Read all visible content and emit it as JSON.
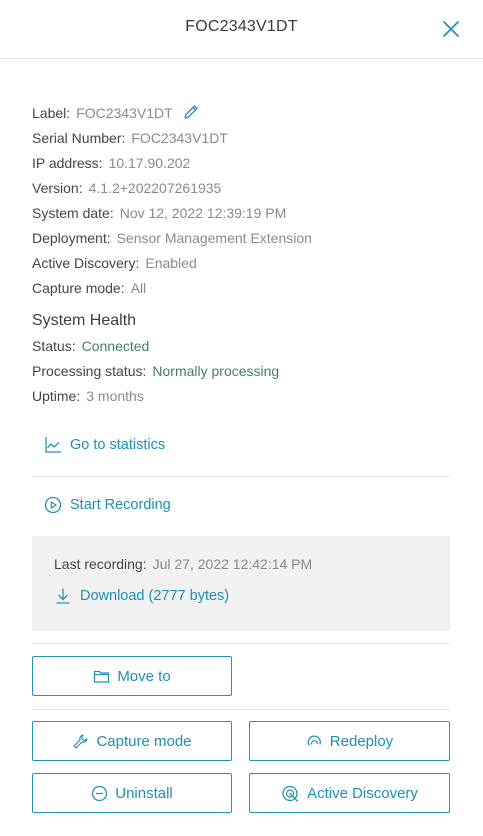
{
  "header": {
    "title": "FOC2343V1DT"
  },
  "info": {
    "label": {
      "key": "Label:",
      "value": "FOC2343V1DT"
    },
    "serial": {
      "key": "Serial Number:",
      "value": "FOC2343V1DT"
    },
    "ip": {
      "key": "IP address:",
      "value": "10.17.90.202"
    },
    "version": {
      "key": "Version:",
      "value": "4.1.2+202207261935"
    },
    "system_date": {
      "key": "System date:",
      "value": "Nov 12, 2022 12:39:19 PM"
    },
    "deployment": {
      "key": "Deployment:",
      "value": "Sensor Management Extension"
    },
    "active_discovery": {
      "key": "Active Discovery:",
      "value": "Enabled"
    },
    "capture_mode": {
      "key": "Capture mode:",
      "value": "All"
    }
  },
  "health": {
    "title": "System Health",
    "status": {
      "key": "Status:",
      "value": "Connected"
    },
    "processing": {
      "key": "Processing status:",
      "value": "Normally processing"
    },
    "uptime": {
      "key": "Uptime:",
      "value": "3 months"
    }
  },
  "links": {
    "statistics": "Go to statistics",
    "start_recording": "Start Recording"
  },
  "recording": {
    "last_label": "Last recording:",
    "last_value": "Jul 27, 2022 12:42:14 PM",
    "download": "Download (2777 bytes)"
  },
  "buttons": {
    "move_to": "Move to",
    "capture_mode": "Capture mode",
    "redeploy": "Redeploy",
    "uninstall": "Uninstall",
    "active_discovery": "Active Discovery"
  },
  "colors": {
    "accent": "#1e8fb3",
    "status_ok": "#3f7f70",
    "muted": "#8a8a8a"
  },
  "icons": {
    "close": "close-icon",
    "edit": "pencil-icon",
    "stats": "chart-line-icon",
    "record": "play-circle-icon",
    "download": "download-icon",
    "move": "folder-icon",
    "capture": "wrench-icon",
    "redeploy": "redeploy-icon",
    "uninstall": "minus-circle-icon",
    "discovery": "radar-icon"
  }
}
